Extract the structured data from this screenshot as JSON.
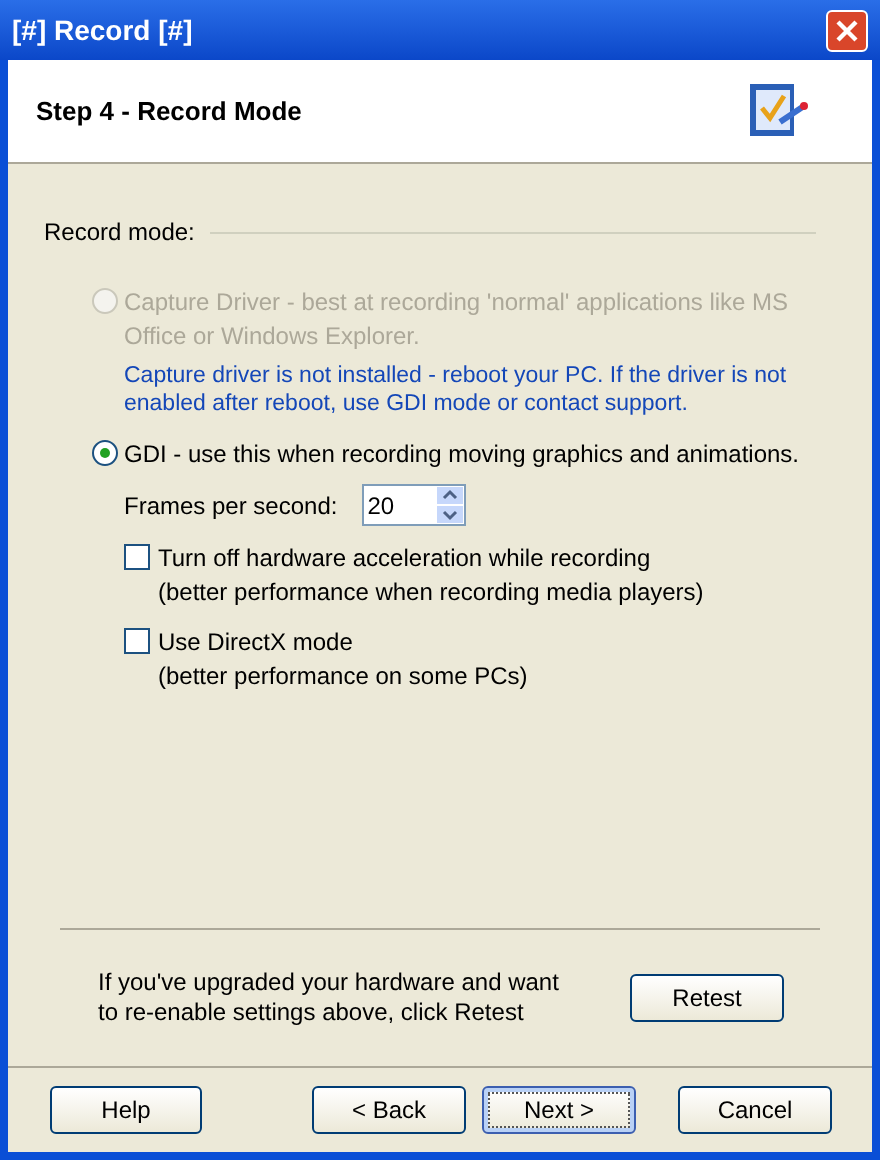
{
  "window": {
    "title": "[#] Record [#]"
  },
  "header": {
    "title": "Step 4 - Record Mode"
  },
  "section": {
    "label": "Record mode:"
  },
  "options": [
    {
      "label": "Capture Driver - best at recording 'normal' applications like MS Office or Windows Explorer.",
      "selected": false,
      "disabled": true,
      "note": "Capture driver is not installed - reboot your PC. If the driver is not enabled after reboot, use GDI mode or contact support."
    },
    {
      "label": "GDI - use this when recording moving graphics and animations.",
      "selected": true,
      "disabled": false
    }
  ],
  "fps": {
    "label": "Frames per second:",
    "value": "20"
  },
  "checkboxes": [
    {
      "label": "Turn off hardware acceleration while recording",
      "hint": "(better performance when recording media players)",
      "checked": false
    },
    {
      "label": "Use DirectX mode",
      "hint": "(better performance on some PCs)",
      "checked": false
    }
  ],
  "retest": {
    "text": "If you've upgraded your hardware and want to re-enable settings above, click Retest",
    "button": "Retest"
  },
  "buttons": [
    {
      "label": "Help",
      "kind": "help",
      "default": false
    },
    {
      "label": "< Back",
      "kind": "nav",
      "default": false
    },
    {
      "label": "Next >",
      "kind": "nav",
      "default": true
    },
    {
      "label": "Cancel",
      "kind": "cancel",
      "default": false
    }
  ]
}
